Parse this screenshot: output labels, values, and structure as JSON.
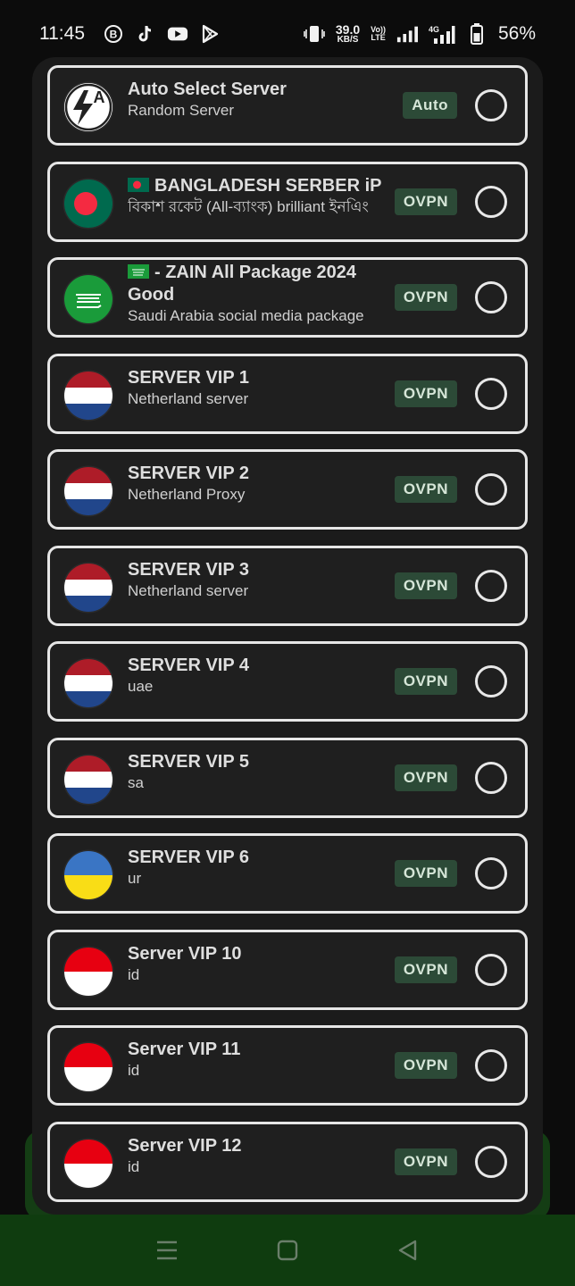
{
  "status_bar": {
    "time": "11:45",
    "net_speed_value": "39.0",
    "net_speed_unit": "KB/S",
    "volte_top": "Vo))",
    "volte_bottom": "LTE",
    "network": "4G",
    "battery": "56%"
  },
  "servers": [
    {
      "name": "Auto Select Server",
      "subtitle": "Random Server",
      "badge": "Auto",
      "flag": "auto"
    },
    {
      "name": "BANGLADESH SERBER iP",
      "subtitle": "বিকাশ রকেট (All-ব্যাংক) brilliant ইনএিং",
      "badge": "OVPN",
      "flag": "bangladesh",
      "name_flag": "bangladesh"
    },
    {
      "name": "- ZAIN All Package 2024 Good",
      "subtitle": "Saudi Arabia social media package",
      "badge": "OVPN",
      "flag": "saudi",
      "name_flag": "saudi"
    },
    {
      "name": "SERVER VIP  1",
      "subtitle": "Netherland server",
      "badge": "OVPN",
      "flag": "netherlands"
    },
    {
      "name": "SERVER VIP 2",
      "subtitle": "Netherland Proxy",
      "badge": "OVPN",
      "flag": "netherlands"
    },
    {
      "name": "SERVER VIP 3",
      "subtitle": "Netherland server",
      "badge": "OVPN",
      "flag": "netherlands"
    },
    {
      "name": "SERVER VIP 4",
      "subtitle": "uae",
      "badge": "OVPN",
      "flag": "netherlands"
    },
    {
      "name": "SERVER VIP 5",
      "subtitle": "sa",
      "badge": "OVPN",
      "flag": "netherlands"
    },
    {
      "name": "SERVER VIP 6",
      "subtitle": "ur",
      "badge": "OVPN",
      "flag": "ukraine"
    },
    {
      "name": "Server VIP 10",
      "subtitle": "id",
      "badge": "OVPN",
      "flag": "indonesia"
    },
    {
      "name": "Server VIP 11",
      "subtitle": "id",
      "badge": "OVPN",
      "flag": "indonesia"
    },
    {
      "name": "Server VIP 12",
      "subtitle": "id",
      "badge": "OVPN",
      "flag": "indonesia"
    }
  ],
  "colors": {
    "badge_bg": "#2c4a37",
    "panel_bg": "#1b1b1b",
    "nav_bg": "#0f3c0f"
  }
}
